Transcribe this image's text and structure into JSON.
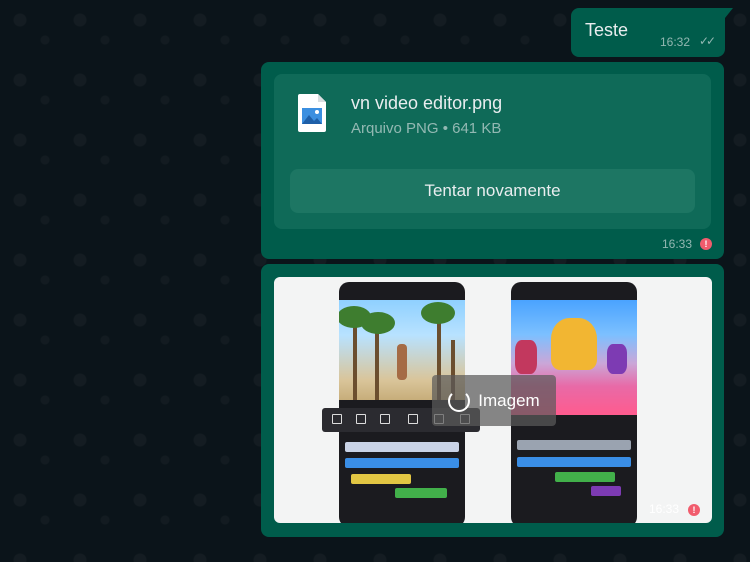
{
  "messages": {
    "text_message": {
      "body": "Teste",
      "time": "16:32",
      "status": "read-ticks"
    },
    "file_message": {
      "file_name": "vn video editor.png",
      "file_info": "Arquivo PNG • 641 KB",
      "retry_label": "Tentar novamente",
      "time": "16:33",
      "status": "error"
    },
    "image_message": {
      "loading_label": "Imagem",
      "time": "16:33",
      "status": "error"
    }
  },
  "colors": {
    "outgoing_bubble": "#005c4b",
    "chat_background": "#0b141a",
    "error": "#f15c6d"
  },
  "icons": [
    "double-check-icon",
    "image-file-icon",
    "error-icon",
    "loading-spinner-icon"
  ]
}
